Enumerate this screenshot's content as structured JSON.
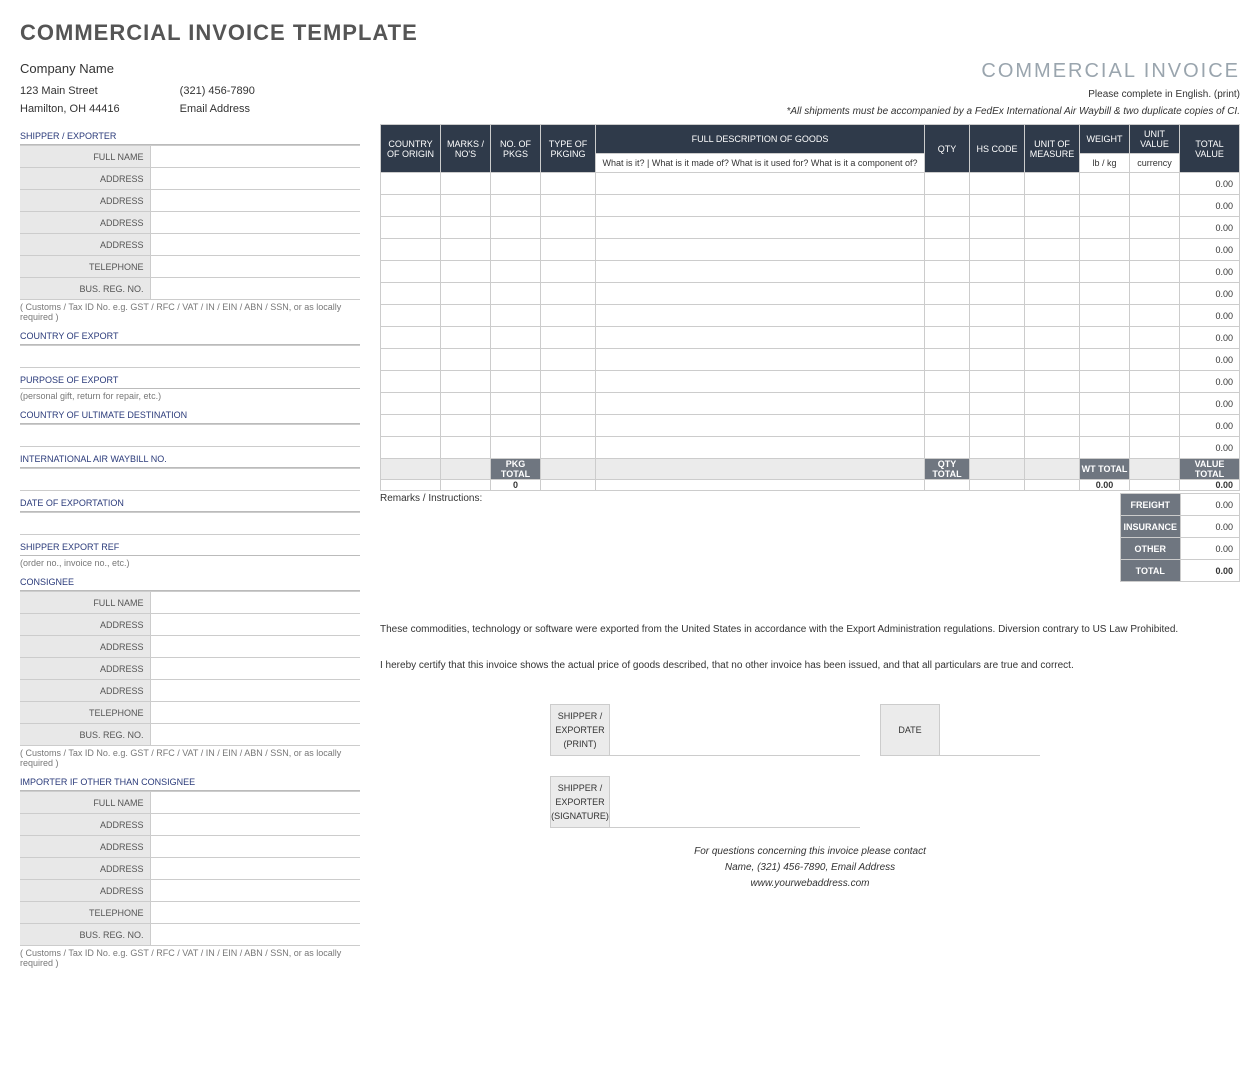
{
  "title": "COMMERCIAL INVOICE TEMPLATE",
  "docTitle": "COMMERCIAL INVOICE",
  "company": {
    "name": "Company Name",
    "addr": "123 Main Street",
    "city": "Hamilton, OH  44416",
    "phone": "(321) 456-7890",
    "email": "Email Address"
  },
  "notes": {
    "lang": "Please complete in English. (print)",
    "ship": "*All shipments must be accompanied by a FedEx International Air Waybill & two duplicate copies of CI."
  },
  "left": {
    "shipper": {
      "head": "SHIPPER / EXPORTER",
      "labels": [
        "FULL NAME",
        "ADDRESS",
        "ADDRESS",
        "ADDRESS",
        "ADDRESS",
        "TELEPHONE",
        "BUS. REG. NO."
      ],
      "note": "( Customs / Tax ID No. e.g. GST / RFC / VAT / IN / EIN / ABN / SSN, or as locally required )"
    },
    "countryExport": "COUNTRY OF EXPORT",
    "purpose": {
      "head": "PURPOSE OF EXPORT",
      "note": "(personal gift, return for repair, etc.)"
    },
    "countryDest": "COUNTRY OF ULTIMATE DESTINATION",
    "waybill": "INTERNATIONAL AIR WAYBILL NO.",
    "dateExp": "DATE OF EXPORTATION",
    "shipRef": {
      "head": "SHIPPER EXPORT REF",
      "note": "(order no., invoice no., etc.)"
    },
    "consignee": {
      "head": "CONSIGNEE",
      "labels": [
        "FULL NAME",
        "ADDRESS",
        "ADDRESS",
        "ADDRESS",
        "ADDRESS",
        "TELEPHONE",
        "BUS. REG. NO."
      ],
      "note": "( Customs / Tax ID No. e.g. GST / RFC / VAT / IN / EIN / ABN / SSN, or as locally required )"
    },
    "importer": {
      "head": "IMPORTER IF OTHER THAN CONSIGNEE",
      "labels": [
        "FULL NAME",
        "ADDRESS",
        "ADDRESS",
        "ADDRESS",
        "ADDRESS",
        "TELEPHONE",
        "BUS. REG. NO."
      ],
      "note": "( Customs / Tax ID No. e.g. GST / RFC / VAT / IN / EIN / ABN / SSN, or as locally required )"
    }
  },
  "goods": {
    "head": {
      "country": "COUNTRY OF ORIGIN",
      "marks": "MARKS / NO'S",
      "noPkg": "NO. OF PKGS",
      "typePkg": "TYPE OF PKGING",
      "desc": "FULL DESCRIPTION OF GOODS",
      "descSub": "What is it? | What is it made of? What is it used for? What is it a component of?",
      "qty": "QTY",
      "hs": "HS CODE",
      "uom": "UNIT OF MEASURE",
      "wt": "WEIGHT",
      "wtSub": "lb / kg",
      "uv": "UNIT VALUE",
      "uvSub": "currency",
      "tv": "TOTAL VALUE"
    },
    "rows": [
      {
        "tv": "0.00"
      },
      {
        "tv": "0.00"
      },
      {
        "tv": "0.00"
      },
      {
        "tv": "0.00"
      },
      {
        "tv": "0.00"
      },
      {
        "tv": "0.00"
      },
      {
        "tv": "0.00"
      },
      {
        "tv": "0.00"
      },
      {
        "tv": "0.00"
      },
      {
        "tv": "0.00"
      },
      {
        "tv": "0.00"
      },
      {
        "tv": "0.00"
      },
      {
        "tv": "0.00"
      }
    ],
    "totals": {
      "pkgHead": "PKG TOTAL",
      "pkgVal": "0",
      "qtyHead": "QTY TOTAL",
      "wtHead": "WT TOTAL",
      "wtVal": "0.00",
      "valHead": "VALUE TOTAL",
      "valVal": "0.00"
    }
  },
  "remarks": "Remarks / Instructions:",
  "summary": {
    "freight": {
      "lbl": "FREIGHT",
      "val": "0.00"
    },
    "insurance": {
      "lbl": "INSURANCE",
      "val": "0.00"
    },
    "other": {
      "lbl": "OTHER",
      "val": "0.00"
    },
    "total": {
      "lbl": "TOTAL",
      "val": "0.00"
    }
  },
  "decl": {
    "l1": "These commodities, technology or software were exported from the United States in accordance with the Export Administration regulations.  Diversion contrary to US Law Prohibited.",
    "l2": "I hereby certify that this invoice shows the actual price of goods described, that no other invoice has been issued, and that all particulars are true and correct."
  },
  "sig": {
    "printL1": "SHIPPER /",
    "printL2": "EXPORTER",
    "printL3": "(PRINT)",
    "date": "DATE",
    "sigL1": "SHIPPER /",
    "sigL2": "EXPORTER",
    "sigL3": "(SIGNATURE)"
  },
  "footer": {
    "l1": "For questions concerning this invoice please contact",
    "l2": "Name, (321) 456-7890, Email Address",
    "l3": "www.yourwebaddress.com"
  }
}
